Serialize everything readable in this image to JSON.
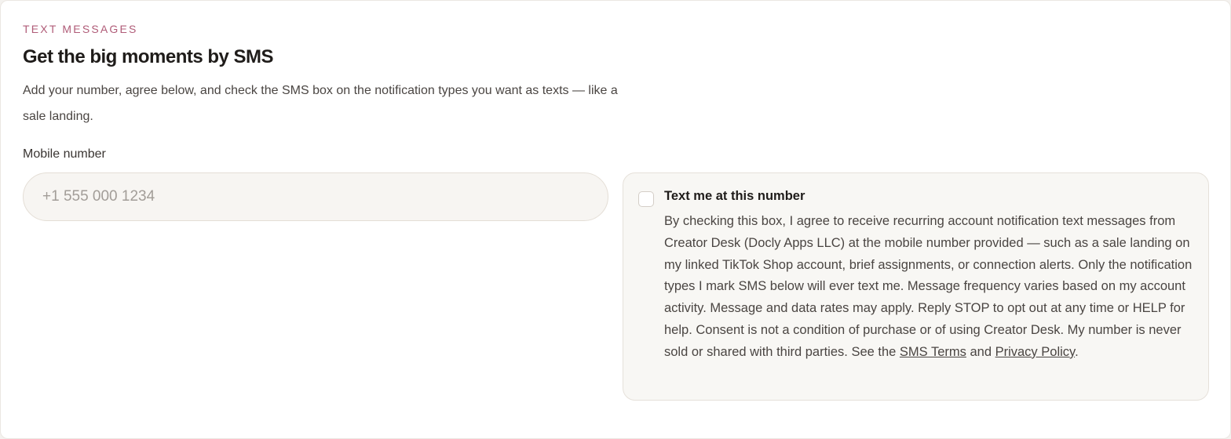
{
  "section": {
    "eyebrow": "TEXT MESSAGES",
    "title": "Get the big moments by SMS",
    "description": "Add your number, agree below, and check the SMS box on the notification types you want as texts — like a sale landing."
  },
  "mobile": {
    "label": "Mobile number",
    "value": "",
    "placeholder": "+1 555 000 1234"
  },
  "consent": {
    "checked": false,
    "title": "Text me at this number",
    "body": "By checking this box, I agree to receive recurring account notification text messages from Creator Desk (Docly Apps LLC) at the mobile number provided — such as a sale landing on my linked TikTok Shop account, brief assignments, or connection alerts. Only the notification types I mark SMS below will ever text me. Message frequency varies based on my account activity. Message and data rates may apply. Reply STOP to opt out at any time or HELP for help. Consent is not a condition of purchase or of using Creator Desk. My number is never sold or shared with third parties. See the ",
    "sms_terms_link": "SMS Terms",
    "and_text": " and ",
    "privacy_link": "Privacy Policy",
    "end_text": "."
  },
  "colors": {
    "accent": "#b05c78",
    "input_bg": "#f7f5f2",
    "panel_bg": "#f8f7f4"
  }
}
